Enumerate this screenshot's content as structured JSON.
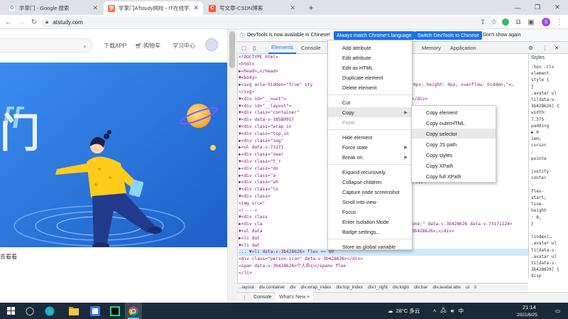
{
  "tabs": [
    {
      "title": "学掌门 - Google 搜索",
      "favicon": "google-icon",
      "active": false
    },
    {
      "title": "学掌门ATstudy网校 - IT在线学习",
      "favicon": "atstudy-icon",
      "active": true
    },
    {
      "title": "写文章-CSDN博客",
      "favicon": "csdn-icon",
      "active": false
    }
  ],
  "new_tab": "+",
  "address": "atstudy.com",
  "site": {
    "nav": [
      "下载APP",
      "购物车",
      "学习中心"
    ],
    "banner_text": "门",
    "below_text": "去看看"
  },
  "devtools": {
    "info": "DevTools is now available in Chinese!",
    "btn_match": "Always match Chrome's language",
    "btn_switch": "Switch DevTools to Chinese",
    "btn_dismiss": "Don't show again",
    "tabs": [
      "Elements",
      "Console",
      "Memory",
      "Application"
    ],
    "styles_tab": "Styles",
    "code_lines": [
      "<!DOCTYPE html>",
      "<html>",
      "  ▶<head>…</head>",
      "  ▼<body>",
      "    ▶<svg aria-hidden=\"true\" sty",
      "      </svg>",
      "    ▼<div id=\"__nuxt\">",
      "      ▼<div id=\"__layout\">",
      "        ▼<div class=\"container\"",
      "          ▼<div data-v-1B5B0917",
      "            ▼<div class=\"wrap_in",
      "              ▼<div class=\"top_in",
      "                ▶<div class=\"img\"",
      "                ▶<ul data-v-73171",
      "                ▶<div class=\"sear",
      "                ▼<div class=\"t_r",
      "                  ▶<div class=\"do",
      "                  ▶<div class=\"a_",
      "                  ▶<div class=\"sh",
      "                  ▼<div class=\"lo",
      "                    ▼<div class=",
      "                        <img src=\"",
      "                        <!---->",
      "                      ▼<div class",
      "                        ▶<div cla",
      "                        ▼<ul data",
      "                          ▶<li dat",
      "                          ▼<li dat",
      "...                       ▼<li data-v-3b428626> flex == $0",
      "                              <div class=\"person-icon\" data-v-3b428626></div>",
      "                              <span data-v-3b428626>个人中心</span> flex",
      "                            </li>"
    ],
    "code_tail": [
      "0px; height: 0px; overflow: hidden;\">…",
      "</div>",
      "73171124>",
      "one;\" data-v-3b428626 data-v-73171124>",
      "3b428626>…</div>"
    ],
    "styles_lines": [
      ":hov .cls",
      "element.",
      "style {",
      "}",
      ".avatar ul",
      "li[data-v-",
      "3b428626] {",
      "  width:",
      "    7.375",
      "  padding",
      "    ▶ 0",
      "    1em;",
      "  cursor",
      "    :",
      "    pointe",
      "",
      "justify-",
      "  conter",
      "    :",
      "  flex-",
      "    start;",
      "  line-",
      "  height",
      "    : 0;",
      "}",
      "",
      "(index)…",
      ".avatar ul",
      "li[data-v-",
      ".avatar ul",
      "li[data-v-",
      "3b428626] {",
      "  disp"
    ],
    "crumbs": [
      "…layout",
      "div.container",
      "div",
      "div.wrap_index",
      "div.top_index",
      "div.t_right",
      "div.login",
      "div.bar",
      "div.avatar.abs",
      "ul",
      "li"
    ],
    "drawer_tabs": [
      "Console",
      "What's New ×"
    ]
  },
  "context_menu": {
    "items": [
      {
        "label": "Add attribute"
      },
      {
        "label": "Edit attribute"
      },
      {
        "label": "Edit as HTML"
      },
      {
        "label": "Duplicate element"
      },
      {
        "label": "Delete element"
      },
      {
        "sep": true
      },
      {
        "label": "Cut"
      },
      {
        "label": "Copy",
        "submenu": true,
        "highlight": true
      },
      {
        "label": "Paste",
        "disabled": true
      },
      {
        "sep": true
      },
      {
        "label": "Hide element"
      },
      {
        "label": "Force state",
        "submenu": true
      },
      {
        "label": "Break on",
        "submenu": true
      },
      {
        "sep": true
      },
      {
        "label": "Expand recursively"
      },
      {
        "label": "Collapse children"
      },
      {
        "label": "Capture node screenshot"
      },
      {
        "label": "Scroll into view"
      },
      {
        "label": "Focus"
      },
      {
        "label": "Enter Isolation Mode"
      },
      {
        "label": "Badge settings..."
      },
      {
        "sep": true
      },
      {
        "label": "Store as global variable"
      }
    ],
    "copy_submenu": [
      "Copy element",
      "Copy outerHTML",
      "Copy selector",
      "Copy JS path",
      "Copy styles",
      "Copy XPath",
      "Copy full XPath"
    ]
  },
  "taskbar": {
    "weather": "28°C 多云",
    "time": "21:14",
    "date": "2021/6/25",
    "ime": "中"
  }
}
